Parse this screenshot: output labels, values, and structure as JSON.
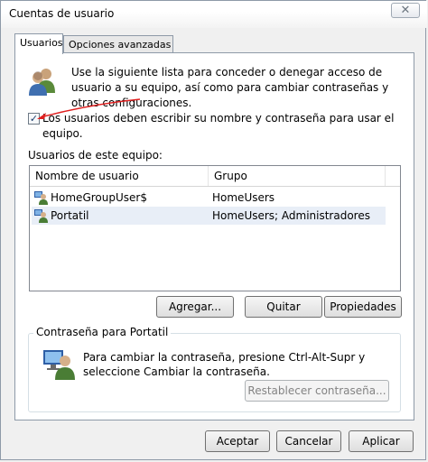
{
  "window": {
    "title": "Cuentas de usuario",
    "close_glyph": "✕"
  },
  "tabs": [
    {
      "label": "Usuarios",
      "active": true
    },
    {
      "label": "Opciones avanzadas",
      "active": false
    }
  ],
  "intro": {
    "icon": "users-icon",
    "text": "Use la siguiente lista para conceder o denegar acceso de usuario a su equipo, así como para cambiar contraseñas y otras configuraciones."
  },
  "require_login": {
    "checked": true,
    "check_glyph": "✓",
    "label": "Los usuarios deben escribir su nombre y contraseña para usar el equipo."
  },
  "users_section": {
    "label": "Usuarios de este equipo:",
    "columns": [
      "Nombre de usuario",
      "Grupo"
    ],
    "rows": [
      {
        "name": "HomeGroupUser$",
        "group": "HomeUsers",
        "selected": false
      },
      {
        "name": "Portatil",
        "group": "HomeUsers; Administradores",
        "selected": true
      }
    ]
  },
  "list_buttons": {
    "add": "Agregar...",
    "remove": "Quitar",
    "properties": "Propiedades"
  },
  "password_group": {
    "title": "Contraseña para Portatil",
    "text": "Para cambiar la contraseña, presione Ctrl-Alt-Supr y seleccione Cambiar la contraseña.",
    "reset_button": "Restablecer contraseña..."
  },
  "dialog_buttons": {
    "ok": "Aceptar",
    "cancel": "Cancelar",
    "apply": "Aplicar"
  },
  "colors": {
    "annotation_arrow": "#e02020",
    "selected_row": "#e8eef7"
  }
}
